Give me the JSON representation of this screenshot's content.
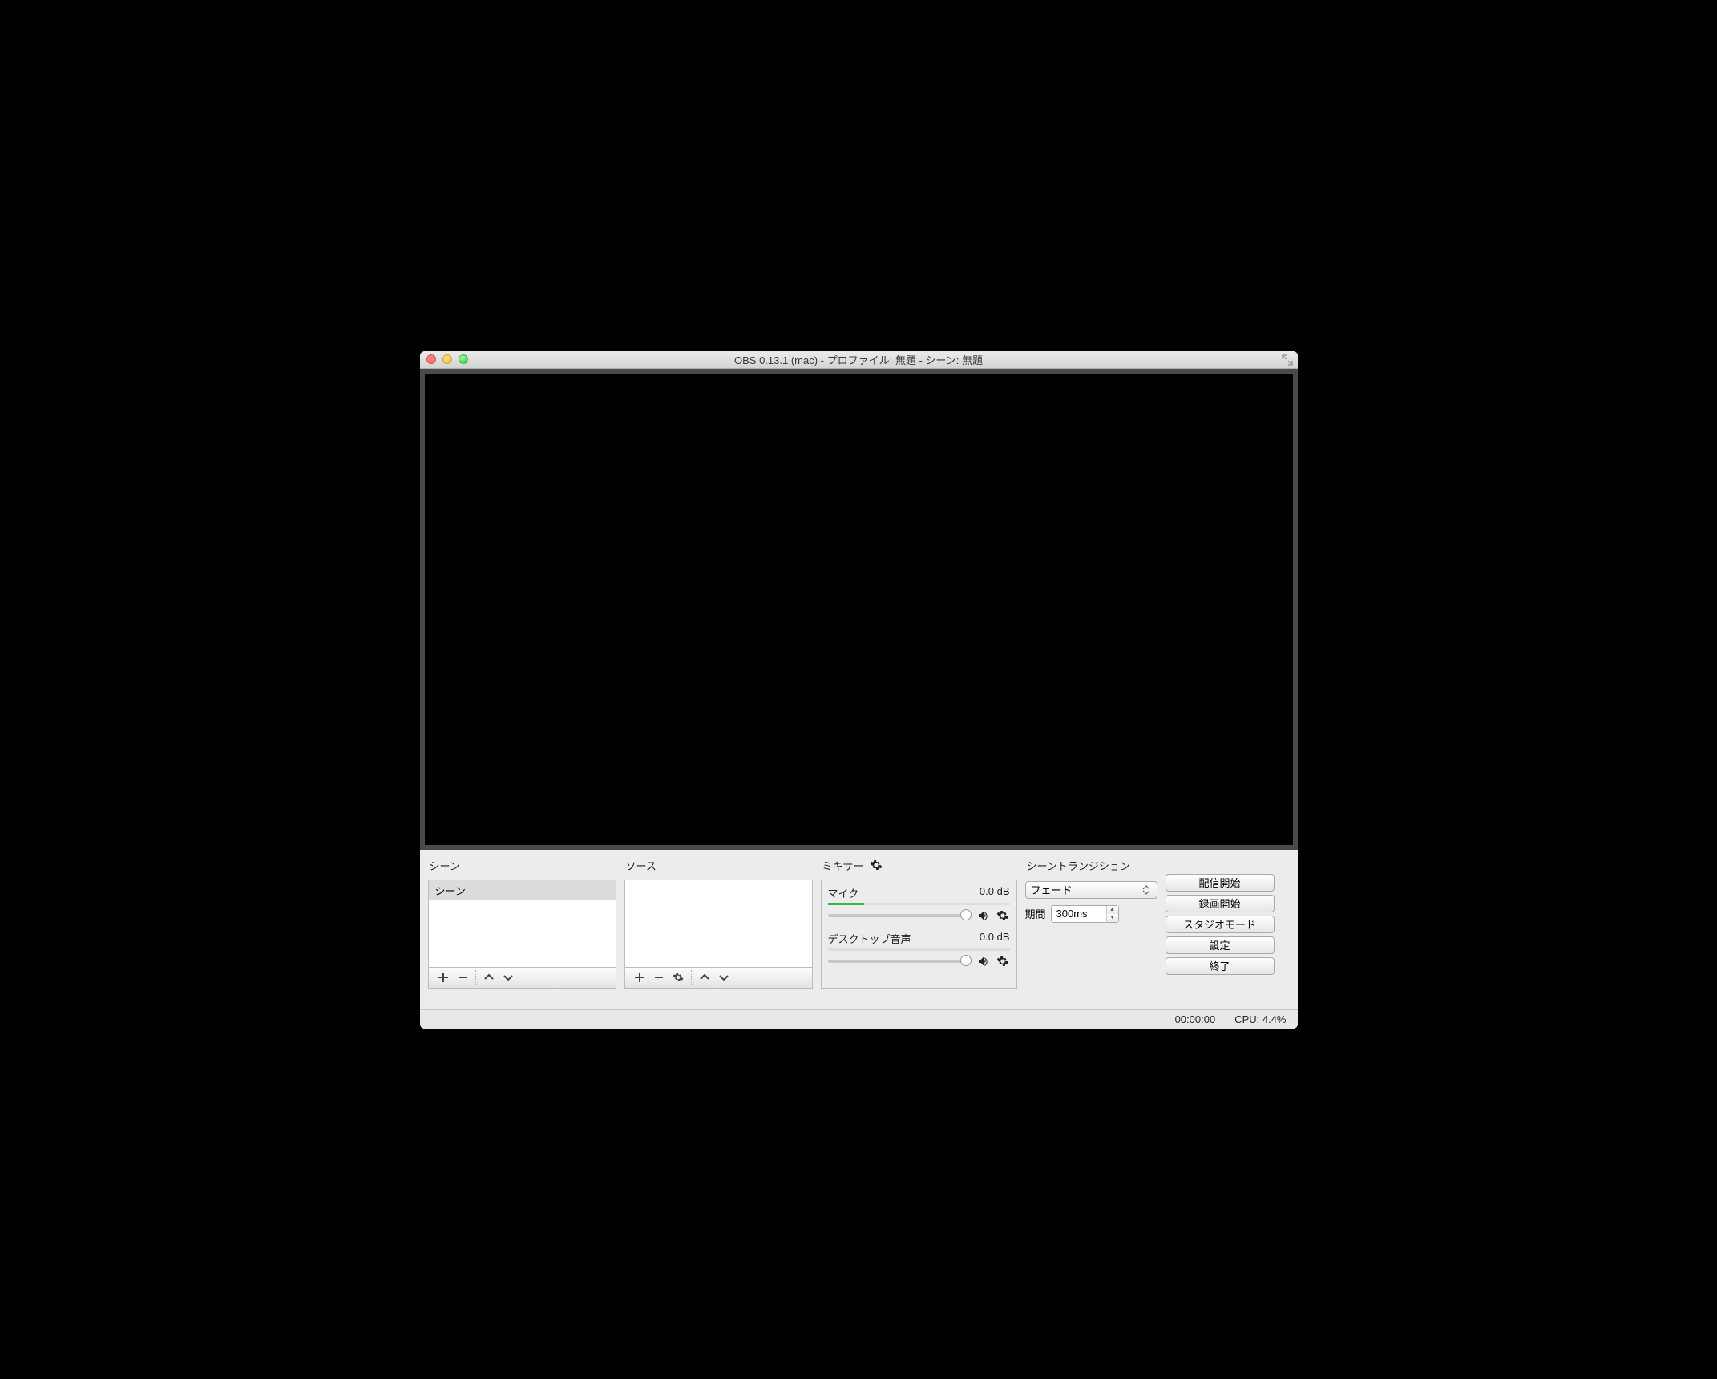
{
  "window": {
    "title": "OBS 0.13.1 (mac) - プロファイル: 無題 - シーン: 無題"
  },
  "panels": {
    "scenes": {
      "title": "シーン",
      "items": [
        "シーン"
      ],
      "selected": 0
    },
    "sources": {
      "title": "ソース",
      "items": []
    },
    "mixer": {
      "title": "ミキサー",
      "channels": [
        {
          "name": "マイク",
          "level": "0.0 dB",
          "meter_pct": 20
        },
        {
          "name": "デスクトップ音声",
          "level": "0.0 dB",
          "meter_pct": 0
        }
      ]
    },
    "transitions": {
      "title": "シーントランジション",
      "selected": "フェード",
      "duration_label": "期間",
      "duration_value": "300ms"
    }
  },
  "controls": {
    "buttons": [
      "配信開始",
      "録画開始",
      "スタジオモード",
      "設定",
      "終了"
    ]
  },
  "status": {
    "time": "00:00:00",
    "cpu": "CPU: 4.4%"
  }
}
